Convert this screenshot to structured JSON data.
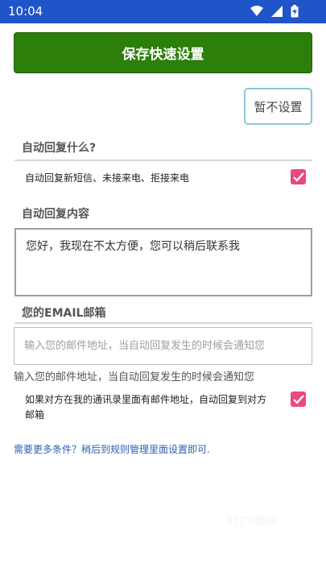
{
  "status_bar": {
    "time": "10:04"
  },
  "actions": {
    "save_label": "保存快速设置",
    "skip_label": "暂不设置"
  },
  "section_what": {
    "title": "自动回复什么?",
    "option_label": "自动回复新短信、未接来电、拒接来电",
    "option_checked": true
  },
  "section_content": {
    "title": "自动回复内容",
    "value": "您好，我现在不太方便，您可以稍后联系我"
  },
  "section_email": {
    "title": "您的EMAIL邮箱",
    "placeholder": "输入您的邮件地址，当自动回复发生的时候会通知您",
    "hint": "输入您的邮件地址，当自动回复发生的时候会通知您",
    "contacts_option_label": "如果对方在我的通讯录里面有邮件地址，自动回复到对方邮箱",
    "contacts_option_checked": true
  },
  "footer": {
    "more_link": "需要更多条件？稍后到规则管理里面设置即可."
  },
  "colors": {
    "status_bar": "#1f55c8",
    "save_button": "#2c7f0a",
    "checkbox": "#e84a7a",
    "link": "#2f5fb3"
  }
}
